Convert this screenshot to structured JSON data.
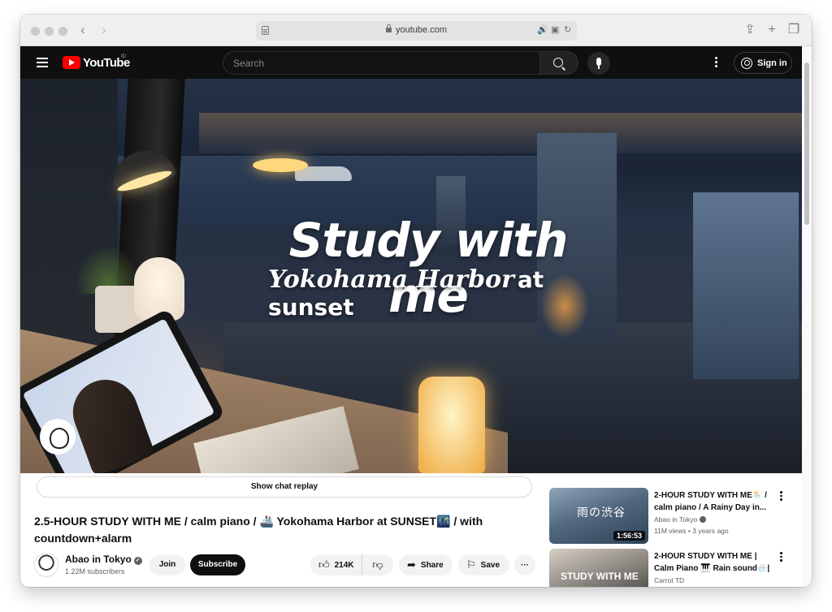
{
  "browser": {
    "url": "youtube.com",
    "tools": [
      "share-icon",
      "new-tab-icon",
      "tabs-overview-icon"
    ]
  },
  "header": {
    "logo_text": "YouTube",
    "logo_region": "ID",
    "search_placeholder": "Search",
    "signin_label": "Sign in"
  },
  "player": {
    "overlay_title": "Study with me",
    "overlay_sub_script": "Yokohama Harbor",
    "overlay_sub_plain": "at sunset"
  },
  "chat_replay": "Show chat replay",
  "video": {
    "title": "2.5-HOUR STUDY WITH ME / calm piano / 🚢 Yokohama Harbor at SUNSET🌃 / with countdown+alarm",
    "channel": "Abao in Tokyo",
    "subscribers": "1.22M subscribers",
    "join_label": "Join",
    "subscribe_label": "Subscribe",
    "likes": "214K",
    "share_label": "Share",
    "save_label": "Save"
  },
  "related": [
    {
      "title": "2-HOUR STUDY WITH ME🌦️ / calm piano / A Rainy Day in...",
      "channel": "Abao in Tokyo",
      "meta": "11M views • 3 years ago",
      "duration": "1:56:53",
      "thumb_text": "雨の渋谷"
    },
    {
      "title": "2-HOUR STUDY WITH ME | Calm Piano 🎹 Rain sound🌧️|",
      "channel": "Carrot TD",
      "meta": "",
      "duration": "",
      "thumb_text": "STUDY WITH ME"
    }
  ]
}
